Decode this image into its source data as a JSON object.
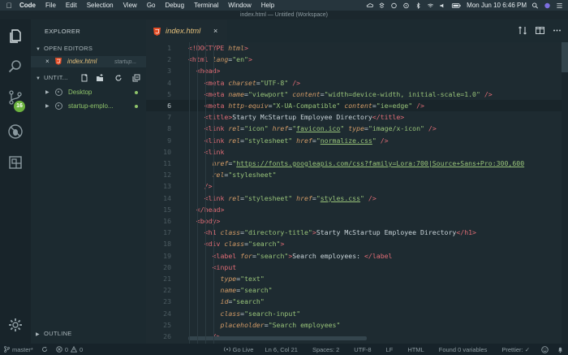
{
  "menubar": {
    "app": "Code",
    "items": [
      "File",
      "Edit",
      "Selection",
      "View",
      "Go",
      "Debug",
      "Terminal",
      "Window",
      "Help"
    ],
    "clock": "Mon Jun 10  6:46 PM"
  },
  "window": {
    "title": "index.html — Untitled (Workspace)"
  },
  "activity_bar": {
    "scm_badge": "16"
  },
  "sidebar": {
    "title": "EXPLORER",
    "open_editors_label": "OPEN EDITORS",
    "open_editor": {
      "close": "×",
      "filename": "index.html",
      "path": "startup..."
    },
    "workspace_label": "UNTIT...",
    "folders": [
      {
        "name": "Desktop"
      },
      {
        "name": "startup-emplo..."
      }
    ],
    "outline_label": "OUTLINE"
  },
  "tabs": [
    {
      "label": "index.html",
      "close": "×"
    }
  ],
  "editor": {
    "current_line": 6,
    "lines": [
      {
        "n": "1",
        "indent": 0,
        "tokens": [
          [
            "t",
            "<!DOCTYPE "
          ],
          [
            "a",
            "html"
          ],
          [
            "t",
            ">"
          ]
        ]
      },
      {
        "n": "2",
        "indent": 0,
        "tokens": [
          [
            "t",
            "<html "
          ],
          [
            "a",
            "lang"
          ],
          [
            "b",
            "="
          ],
          [
            "s",
            "\"en\""
          ],
          [
            "t",
            ">"
          ]
        ]
      },
      {
        "n": "3",
        "indent": 1,
        "tokens": [
          [
            "t",
            "<head>"
          ]
        ]
      },
      {
        "n": "4",
        "indent": 2,
        "tokens": [
          [
            "t",
            "<meta "
          ],
          [
            "a",
            "charset"
          ],
          [
            "b",
            "="
          ],
          [
            "s",
            "\"UTF-8\""
          ],
          [
            "b",
            " "
          ],
          [
            "t",
            "/>"
          ]
        ]
      },
      {
        "n": "5",
        "indent": 2,
        "tokens": [
          [
            "t",
            "<meta "
          ],
          [
            "a",
            "name"
          ],
          [
            "b",
            "="
          ],
          [
            "s",
            "\"viewport\""
          ],
          [
            "b",
            " "
          ],
          [
            "a",
            "content"
          ],
          [
            "b",
            "="
          ],
          [
            "s",
            "\"width=device-width, initial-scale=1.0\""
          ],
          [
            "b",
            " "
          ],
          [
            "t",
            "/>"
          ]
        ]
      },
      {
        "n": "6",
        "indent": 2,
        "tokens": [
          [
            "t",
            "<meta "
          ],
          [
            "a",
            "http-equiv"
          ],
          [
            "b",
            "="
          ],
          [
            "s",
            "\"X-UA-Compatible\""
          ],
          [
            "b",
            " "
          ],
          [
            "a",
            "content"
          ],
          [
            "b",
            "="
          ],
          [
            "s",
            "\"ie=edge\""
          ],
          [
            "b",
            " "
          ],
          [
            "t",
            "/>"
          ]
        ]
      },
      {
        "n": "7",
        "indent": 2,
        "tokens": [
          [
            "t",
            "<title>"
          ],
          [
            "b",
            "Starty McStartup Employee Directory"
          ],
          [
            "t",
            "</title>"
          ]
        ]
      },
      {
        "n": "8",
        "indent": 2,
        "tokens": [
          [
            "t",
            "<link "
          ],
          [
            "a",
            "rel"
          ],
          [
            "b",
            "="
          ],
          [
            "s",
            "\"icon\""
          ],
          [
            "b",
            " "
          ],
          [
            "a",
            "href"
          ],
          [
            "b",
            "="
          ],
          [
            "s",
            "\""
          ],
          [
            "u",
            "favicon.ico"
          ],
          [
            "s",
            "\""
          ],
          [
            "b",
            " "
          ],
          [
            "a",
            "type"
          ],
          [
            "b",
            "="
          ],
          [
            "s",
            "\"image/x-icon\""
          ],
          [
            "b",
            " "
          ],
          [
            "t",
            "/>"
          ]
        ]
      },
      {
        "n": "9",
        "indent": 2,
        "tokens": [
          [
            "t",
            "<link "
          ],
          [
            "a",
            "rel"
          ],
          [
            "b",
            "="
          ],
          [
            "s",
            "\"stylesheet\""
          ],
          [
            "b",
            " "
          ],
          [
            "a",
            "href"
          ],
          [
            "b",
            "="
          ],
          [
            "s",
            "\""
          ],
          [
            "u",
            "normalize.css"
          ],
          [
            "s",
            "\""
          ],
          [
            "b",
            " "
          ],
          [
            "t",
            "/>"
          ]
        ]
      },
      {
        "n": "10",
        "indent": 2,
        "tokens": [
          [
            "t",
            "<link"
          ]
        ]
      },
      {
        "n": "11",
        "indent": 3,
        "tokens": [
          [
            "a",
            "href"
          ],
          [
            "b",
            "="
          ],
          [
            "s",
            "\""
          ],
          [
            "u",
            "https://fonts.googleapis.com/css?family=Lora:700|Source+Sans+Pro:300,600"
          ]
        ]
      },
      {
        "n": "12",
        "indent": 3,
        "tokens": [
          [
            "a",
            "rel"
          ],
          [
            "b",
            "="
          ],
          [
            "s",
            "\"stylesheet\""
          ]
        ]
      },
      {
        "n": "13",
        "indent": 2,
        "tokens": [
          [
            "t",
            "/>"
          ]
        ]
      },
      {
        "n": "14",
        "indent": 2,
        "tokens": [
          [
            "t",
            "<link "
          ],
          [
            "a",
            "rel"
          ],
          [
            "b",
            "="
          ],
          [
            "s",
            "\"stylesheet\""
          ],
          [
            "b",
            " "
          ],
          [
            "a",
            "href"
          ],
          [
            "b",
            "="
          ],
          [
            "s",
            "\""
          ],
          [
            "u",
            "styles.css"
          ],
          [
            "s",
            "\""
          ],
          [
            "b",
            " "
          ],
          [
            "t",
            "/>"
          ]
        ]
      },
      {
        "n": "15",
        "indent": 1,
        "tokens": [
          [
            "t",
            "</head>"
          ]
        ]
      },
      {
        "n": "16",
        "indent": 1,
        "tokens": [
          [
            "t",
            "<body>"
          ]
        ]
      },
      {
        "n": "17",
        "indent": 2,
        "tokens": [
          [
            "t",
            "<h1 "
          ],
          [
            "a",
            "class"
          ],
          [
            "b",
            "="
          ],
          [
            "s",
            "\"directory-title\""
          ],
          [
            "t",
            ">"
          ],
          [
            "b",
            "Starty McStartup Employee Directory"
          ],
          [
            "t",
            "</h1>"
          ]
        ]
      },
      {
        "n": "18",
        "indent": 2,
        "tokens": [
          [
            "t",
            "<div "
          ],
          [
            "a",
            "class"
          ],
          [
            "b",
            "="
          ],
          [
            "s",
            "\"search\""
          ],
          [
            "t",
            ">"
          ]
        ]
      },
      {
        "n": "19",
        "indent": 3,
        "tokens": [
          [
            "t",
            "<label "
          ],
          [
            "a",
            "for"
          ],
          [
            "b",
            "="
          ],
          [
            "s",
            "\"search\""
          ],
          [
            "t",
            ">"
          ],
          [
            "b",
            "Search employees: "
          ],
          [
            "t",
            "</label"
          ]
        ]
      },
      {
        "n": "20",
        "indent": 3,
        "tokens": [
          [
            "t",
            "<input"
          ]
        ]
      },
      {
        "n": "21",
        "indent": 4,
        "tokens": [
          [
            "a",
            "type"
          ],
          [
            "b",
            "="
          ],
          [
            "s",
            "\"text\""
          ]
        ]
      },
      {
        "n": "22",
        "indent": 4,
        "tokens": [
          [
            "a",
            "name"
          ],
          [
            "b",
            "="
          ],
          [
            "s",
            "\"search\""
          ]
        ]
      },
      {
        "n": "23",
        "indent": 4,
        "tokens": [
          [
            "a",
            "id"
          ],
          [
            "b",
            "="
          ],
          [
            "s",
            "\"search\""
          ]
        ]
      },
      {
        "n": "24",
        "indent": 4,
        "tokens": [
          [
            "a",
            "class"
          ],
          [
            "b",
            "="
          ],
          [
            "s",
            "\"search-input\""
          ]
        ]
      },
      {
        "n": "25",
        "indent": 4,
        "tokens": [
          [
            "a",
            "placeholder"
          ],
          [
            "b",
            "="
          ],
          [
            "s",
            "\"Search employees\""
          ]
        ]
      },
      {
        "n": "26",
        "indent": 3,
        "tokens": [
          [
            "t",
            "/>"
          ]
        ]
      }
    ]
  },
  "statusbar": {
    "branch": "master*",
    "sync": "",
    "errors": "0",
    "warnings": "0",
    "golive": "Go Live",
    "position": "Ln 6, Col 21",
    "spaces": "Spaces: 2",
    "encoding": "UTF-8",
    "eol": "LF",
    "language": "HTML",
    "variables": "Found 0 variables",
    "prettier": "Prettier: ✓"
  },
  "colors": {
    "tag": "#e06c75",
    "attribute": "#d19a66",
    "string": "#98c379",
    "badge": "#6cb33f",
    "filename": "#e5c07b"
  }
}
